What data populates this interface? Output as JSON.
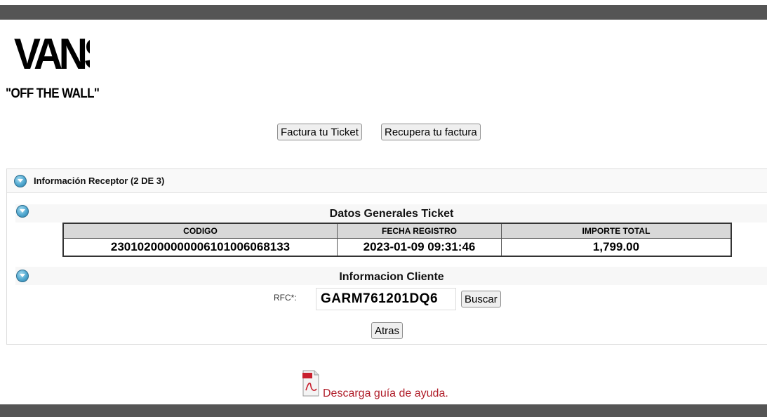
{
  "brand": {
    "logo_text": "VANS",
    "tagline": "\"OFF THE WALL\""
  },
  "nav": {
    "factura_label": "Factura tu Ticket",
    "recupera_label": "Recupera tu factura"
  },
  "panel": {
    "title": "Información Receptor (2 DE 3)"
  },
  "ticket": {
    "section_title": "Datos Generales Ticket",
    "columns": [
      "CODIGO",
      "FECHA REGISTRO",
      "IMPORTE TOTAL"
    ],
    "rows": [
      [
        "230102000000006101006068133",
        "2023-01-09 09:31:46",
        "1,799.00"
      ]
    ]
  },
  "cliente": {
    "section_title": "Informacion Cliente",
    "rfc_label": "RFC*:",
    "rfc_value": "GARM761201DQ6",
    "buscar_label": "Buscar",
    "atras_label": "Atras"
  },
  "help": {
    "link_text": "Descarga guía de ayuda."
  },
  "colors": {
    "bar": "#555555",
    "link": "#b01e2a",
    "accent_icon": "#4fa7cf"
  }
}
